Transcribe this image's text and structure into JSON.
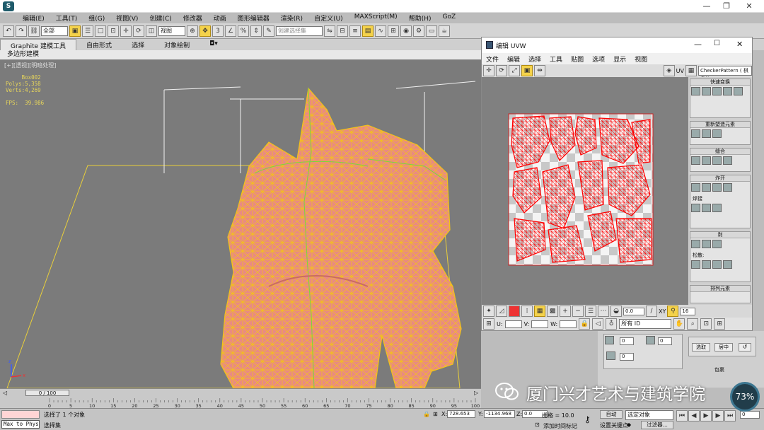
{
  "menu": [
    "编辑(E)",
    "工具(T)",
    "组(G)",
    "视图(V)",
    "创建(C)",
    "修改器",
    "动画",
    "图形编辑器",
    "渲染(R)",
    "自定义(U)",
    "MAXScript(M)",
    "帮助(H)",
    "GoZ"
  ],
  "toolbar": {
    "filter_value": "全部",
    "ref_coord": "视图",
    "named_sel_placeholder": "创建选择集"
  },
  "ribbon": {
    "tabs": [
      "Graphite 建模工具",
      "自由形式",
      "选择",
      "对象绘制"
    ],
    "active_tab": 0,
    "sub_tab": "多边形建模"
  },
  "viewport": {
    "label": "[+][透视][明暗处理]",
    "stats": "     Box002\nPolys:5,358\nVerts:4,269\n\nFPS:  39.986"
  },
  "uvw": {
    "title": "编辑 UVW",
    "menu": [
      "文件",
      "编辑",
      "选择",
      "工具",
      "贴图",
      "选项",
      "显示",
      "视图"
    ],
    "uv_label": "UV",
    "pattern_select": "CheckerPattern ( 棋盘格",
    "panel_groups": [
      "快速变换",
      "重新塑造元素",
      "缝合",
      "炸开",
      "焊接",
      "剥",
      "排列元素"
    ],
    "weld_label": "焊接",
    "peel_label": "松散:",
    "bottom": {
      "u_label": "U:",
      "v_label": "V:",
      "w_label": "W:",
      "spin1": "0.0",
      "spin2": "16",
      "id_select": "所有 ID",
      "xy": "XY"
    }
  },
  "timeline": {
    "slider": "0 / 100",
    "ticks": [
      "0",
      "5",
      "10",
      "15",
      "20",
      "25",
      "30",
      "35",
      "40",
      "45",
      "50",
      "55",
      "60",
      "65",
      "70",
      "75",
      "80",
      "85",
      "90",
      "95",
      "100"
    ],
    "current": 0,
    "total": 100
  },
  "status": {
    "selected": "选择了 1 个对象",
    "prompt": "选择集",
    "max_to_phys": "Max to Phys",
    "x_label": "X:",
    "x_value": "728.653",
    "y_label": "Y:",
    "y_value": "-1134.968",
    "z_label": "Z:",
    "z_value": "0.0",
    "grid": "栅格 = 10.0",
    "add_key": "添加时间标记",
    "auto_key": "自动",
    "set_key": "设置关键点",
    "key_filter_select": "选定对象",
    "filters": "过滤器...",
    "frame": "0"
  },
  "cmd_panel": {
    "spin_a": "0",
    "spin_b": "0",
    "spin_c": "0",
    "btn_a": "选取",
    "btn_b": "居中"
  },
  "right_panel": {
    "wrap_label": "包裹"
  },
  "watermark": "厦门兴才艺术与建筑学院",
  "badge": "73%",
  "colors": {
    "mesh": "#e98a82",
    "wire": "#f2c318",
    "uv_wire": "#ff0000",
    "viewport_bg": "#7b7b7b"
  }
}
